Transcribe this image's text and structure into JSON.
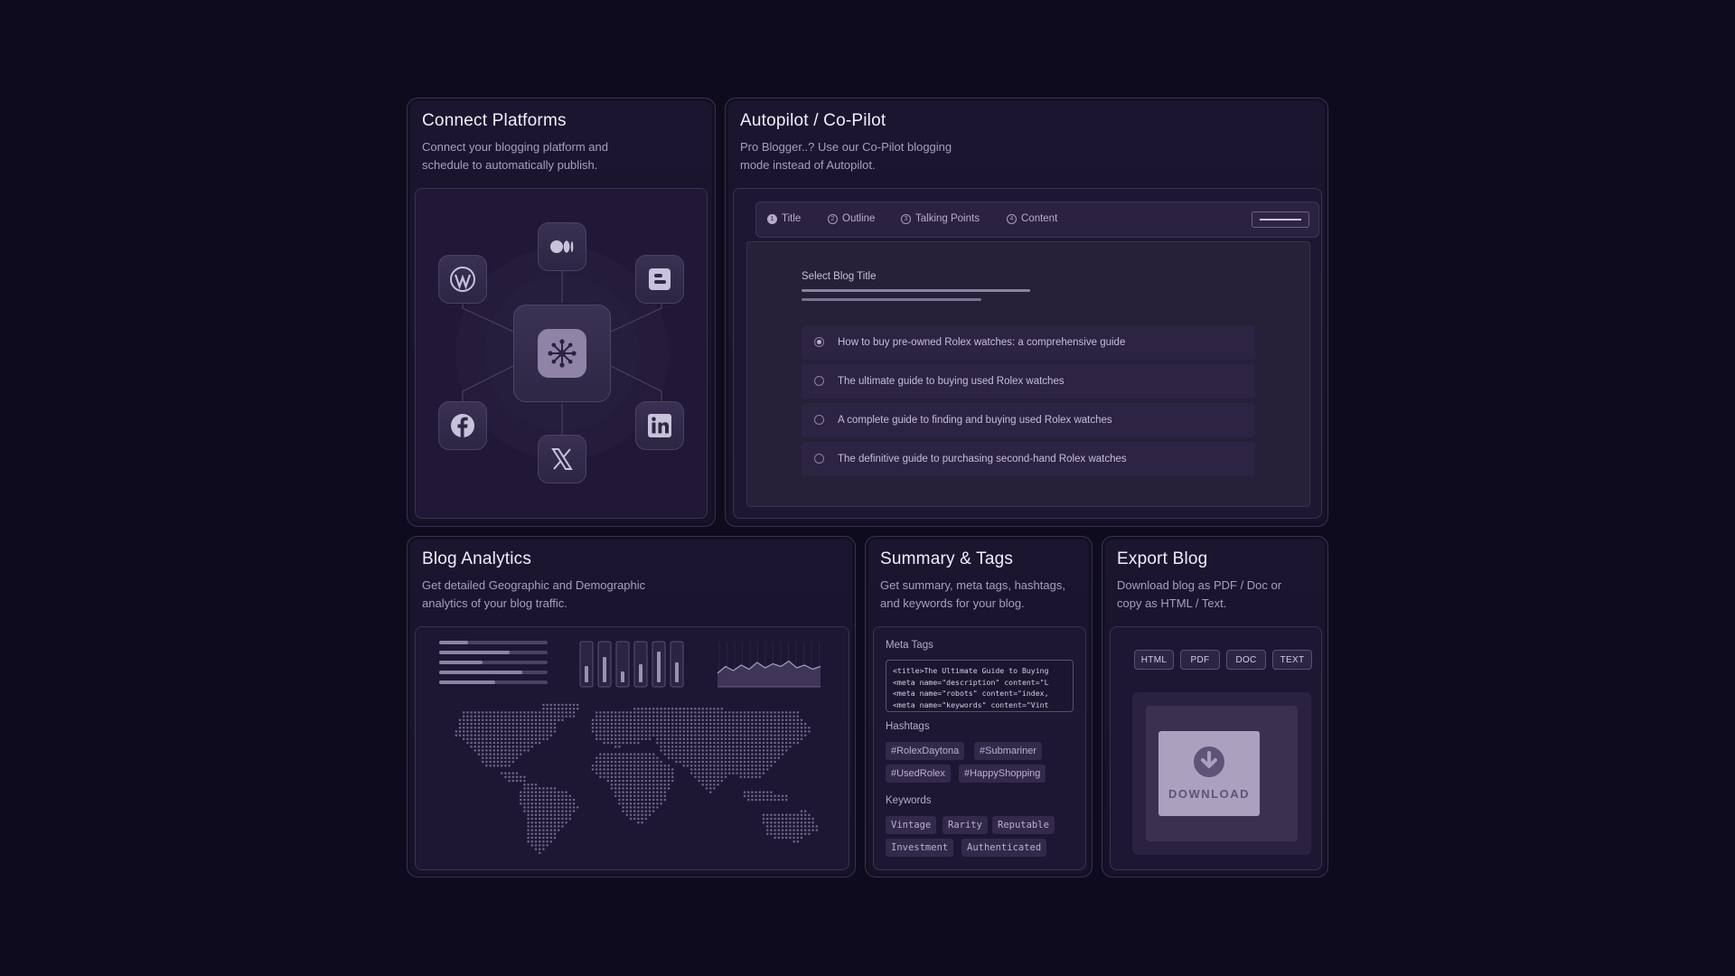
{
  "connect": {
    "title": "Connect Platforms",
    "desc": "Connect your blogging platform and\nschedule to automatically publish."
  },
  "autopilot": {
    "title": "Autopilot / Co-Pilot",
    "desc": "Pro Blogger..?  Use our Co-Pilot blogging\nmode instead of Autopilot.",
    "steps": [
      {
        "num": "1",
        "label": "Title"
      },
      {
        "num": "2",
        "label": "Outline"
      },
      {
        "num": "3",
        "label": "Talking Points"
      },
      {
        "num": "4",
        "label": "Content"
      }
    ],
    "select_label": "Select Blog Title",
    "options": [
      "How to buy pre-owned Rolex watches: a comprehensive guide",
      "The ultimate guide to buying used Rolex watches",
      "A complete guide to finding and buying used Rolex watches",
      "The definitive guide to purchasing second-hand Rolex watches"
    ],
    "selected_index": 0
  },
  "analytics": {
    "title": "Blog Analytics",
    "desc": "Get detailed Geographic and Demographic\nanalytics of your blog traffic.",
    "bar_levels": [
      0.45,
      0.7,
      0.3,
      0.5,
      0.85,
      0.55
    ],
    "line_levels": [
      0.3,
      0.55,
      0.4,
      0.6,
      0.45,
      0.7,
      0.5,
      0.65,
      0.55,
      0.75,
      0.5,
      0.6,
      0.45,
      0.55
    ]
  },
  "summary": {
    "title": "Summary & Tags",
    "desc": "Get summary, meta tags, hashtags,\nand keywords for your blog.",
    "meta_label": "Meta Tags",
    "meta_code": "<title>The Ultimate Guide to Buying\n<meta name=\"description\" content=\"L\n<meta name=\"robots\" content=\"index,\n<meta name=\"keywords\" content=\"Vint",
    "hashtags_label": "Hashtags",
    "hashtags": [
      "#RolexDaytona",
      "#Submariner",
      "#UsedRolex",
      "#HappyShopping"
    ],
    "keywords_label": "Keywords",
    "keywords": [
      "Vintage",
      "Rarity",
      "Reputable",
      "Investment",
      "Authenticated"
    ]
  },
  "export": {
    "title": "Export Blog",
    "desc": "Download blog as PDF / Doc or\ncopy as HTML / Text.",
    "formats": [
      "HTML",
      "PDF",
      "DOC",
      "TEXT"
    ],
    "download_label": "DOWNLOAD"
  },
  "icons": {
    "wordpress": "wordpress-icon",
    "medium": "medium-icon",
    "blogger": "blogger-icon",
    "facebook": "facebook-icon",
    "x": "x-icon",
    "linkedin": "linkedin-icon",
    "hub": "sparkle-burst-icon",
    "download": "download-arrow-icon"
  },
  "colors": {
    "background": "#0f0b1e",
    "card": "#1b1530",
    "accent": "#b4acc8"
  }
}
